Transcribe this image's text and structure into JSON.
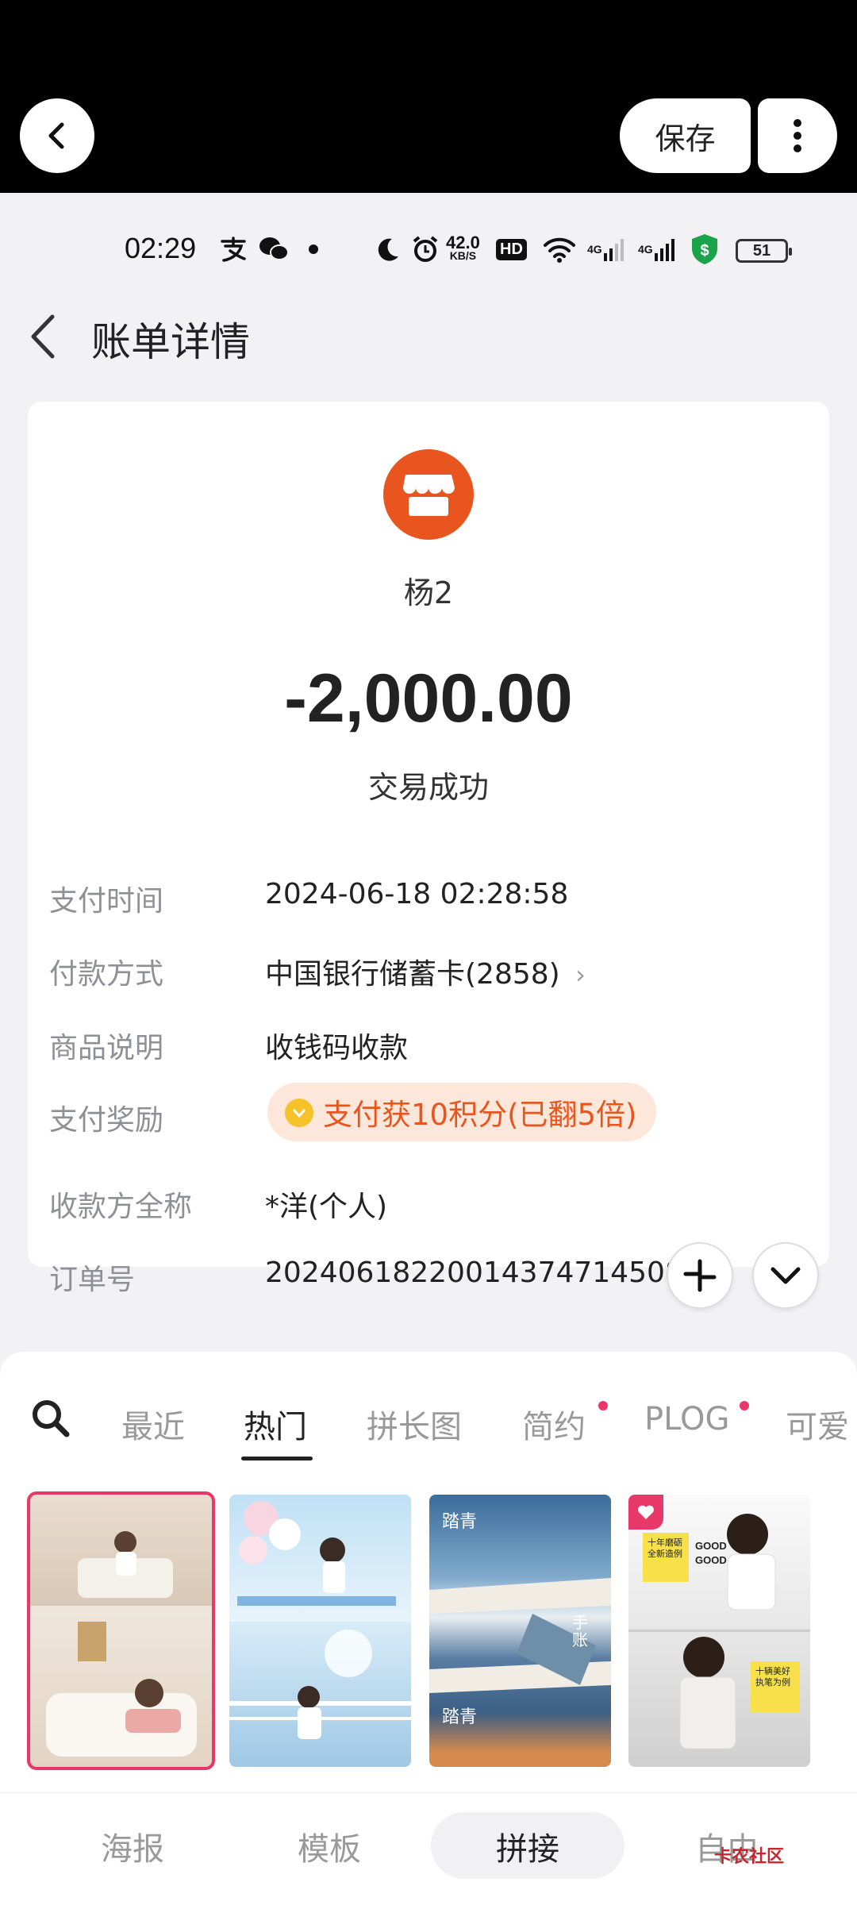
{
  "editor": {
    "save_label": "保存"
  },
  "status_bar": {
    "time": "02:29",
    "net_speed_value": "42.0",
    "net_speed_unit": "KB/S",
    "hd_label": "HD",
    "signal_1_label": "4G",
    "signal_2_label": "4G",
    "battery": "51"
  },
  "page": {
    "title": "账单详情"
  },
  "bill": {
    "payee_name": "杨2",
    "amount": "-2,000.00",
    "status": "交易成功",
    "rows": [
      {
        "label": "支付时间",
        "value": "2024-06-18 02:28:58"
      },
      {
        "label": "付款方式",
        "value": "中国银行储蓄卡(2858)"
      },
      {
        "label": "商品说明",
        "value": "收钱码收款"
      },
      {
        "label": "支付奖励",
        "value": "支付获10积分(已翻5倍)"
      },
      {
        "label": "收款方全称",
        "value": "*洋(个人)"
      },
      {
        "label": "订单号",
        "value": "2024061822001437471450878"
      }
    ]
  },
  "template_sheet": {
    "tabs": [
      "最近",
      "热门",
      "拼长图",
      "简约",
      "PLOG",
      "可爱"
    ],
    "active_tab": "热门",
    "thumb_texts": {
      "t3_top": "踏青",
      "t3_bottom": "踏青",
      "t3_side": "手账",
      "t4_note1": "十年磨砺 全新造例",
      "t4_good": "GOOD GOOD",
      "t4_note2": "十辆美好 执笔为例"
    }
  },
  "bottom_nav": {
    "items": [
      "海报",
      "模板",
      "拼接",
      "自由"
    ],
    "active": "拼接",
    "watermark": "卡农社区"
  },
  "colors": {
    "accent_orange": "#e8551f",
    "accent_pink": "#e8386a",
    "card_bg": "#ffffff",
    "page_bg": "#f2f2f4"
  }
}
